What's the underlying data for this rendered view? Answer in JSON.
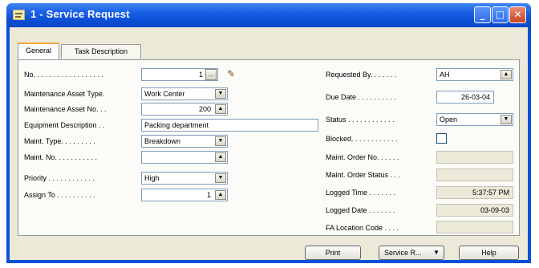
{
  "window": {
    "title": "1 - Service Request"
  },
  "tabs": [
    {
      "label": "General",
      "active": true
    },
    {
      "label": "Task Description",
      "active": false
    }
  ],
  "left_fields": {
    "no": {
      "label": "No. . . . . . . . . . . . . . . . . .",
      "value": "1"
    },
    "maintenance_asset_type": {
      "label": "Maintenance Asset Type.",
      "value": "Work Center"
    },
    "maintenance_asset_no": {
      "label": "Maintenance Asset No. . .",
      "value": "200"
    },
    "equipment_description": {
      "label": "Equipment Description . .",
      "value": "Packing department"
    },
    "maint_type": {
      "label": "Maint. Type. . . . . . . . .",
      "value": "Breakdown"
    },
    "maint_no": {
      "label": "Maint. No. . . . . . . . . . .",
      "value": ""
    },
    "priority": {
      "label": "Priority . . . . . . . . . . . .",
      "value": "High"
    },
    "assign_to": {
      "label": "Assign To . . . . . . . . . .",
      "value": "1"
    }
  },
  "right_fields": {
    "requested_by": {
      "label": "Requested By. . . . . . .",
      "value": "AH"
    },
    "due_date": {
      "label": "Due Date . . . . . . . . . .",
      "value": "26-03-04"
    },
    "status": {
      "label": "Status . . . . . . . . . . . .",
      "value": "Open"
    },
    "blocked": {
      "label": "Blocked. . . . . . . . . . . .",
      "checked": false
    },
    "maint_order_no": {
      "label": "Maint. Order No. . . . . .",
      "value": ""
    },
    "maint_order_status": {
      "label": "Maint. Order Status . . .",
      "value": ""
    },
    "logged_time": {
      "label": "Logged Time . . . . . . .",
      "value": "5:37:57 PM"
    },
    "logged_date": {
      "label": "Logged Date . . . . . . .",
      "value": "03-09-03"
    },
    "fa_location_code": {
      "label": "FA Location Code . . . .",
      "value": ""
    }
  },
  "buttons": {
    "print": "Print",
    "service_request": "Service R...",
    "help": "Help"
  },
  "icons": {
    "window": "form-icon",
    "assist_edit": "assist-edit-icon",
    "edit": "pencil-icon",
    "dropdown": "dropdown-arrow-icon",
    "lookup": "lookup-arrow-icon"
  },
  "colors": {
    "titlebar": "#0a50d8",
    "client_bg": "#ece9d8",
    "field_border": "#7f9db9",
    "active_tab_accent": "#f4a53b"
  }
}
